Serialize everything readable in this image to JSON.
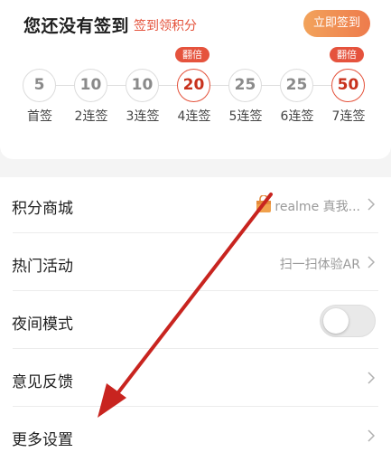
{
  "colors": {
    "accent": "#e4513a",
    "button_gradient_start": "#f2a35b",
    "button_gradient_end": "#ee7b4c",
    "annotation_arrow": "#c8241f",
    "page_background": "#f4f4f4"
  },
  "checkin": {
    "title": "您还没有签到",
    "subtitle": "签到领积分",
    "button_label": "立即签到",
    "double_badge": "翻倍",
    "days": [
      {
        "points": "5",
        "label": "首签",
        "double": false
      },
      {
        "points": "10",
        "label": "2连签",
        "double": false
      },
      {
        "points": "10",
        "label": "3连签",
        "double": false
      },
      {
        "points": "20",
        "label": "4连签",
        "double": true
      },
      {
        "points": "25",
        "label": "5连签",
        "double": false
      },
      {
        "points": "25",
        "label": "6连签",
        "double": false
      },
      {
        "points": "50",
        "label": "7连签",
        "double": true
      }
    ]
  },
  "settings": {
    "points_mall": {
      "label": "积分商城",
      "value": "realme 真我...",
      "icon": "shopping-bag-icon"
    },
    "hot_events": {
      "label": "热门活动",
      "value": "扫一扫体验AR"
    },
    "night_mode": {
      "label": "夜间模式",
      "enabled": false
    },
    "feedback": {
      "label": "意见反馈"
    },
    "more_settings": {
      "label": "更多设置"
    }
  }
}
